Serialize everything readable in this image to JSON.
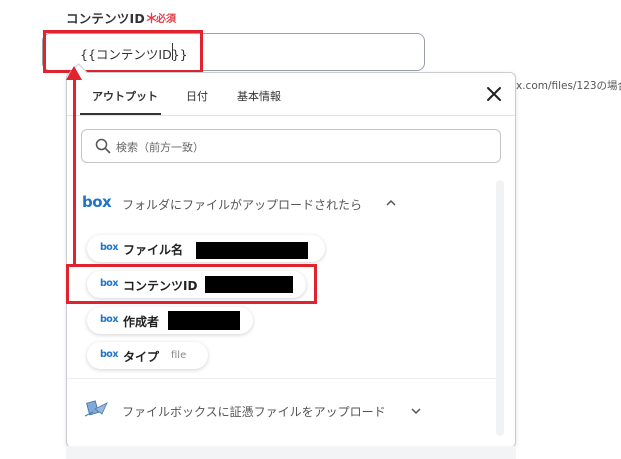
{
  "field": {
    "label": "コンテンツID",
    "required_star": "＊",
    "required_text": "必須",
    "value": "{{コンテンツID}}"
  },
  "background_hint": "x.com/files/123の場合、",
  "panel": {
    "tabs": [
      {
        "label": "アウトプット",
        "active": true
      },
      {
        "label": "日付",
        "active": false
      },
      {
        "label": "基本情報",
        "active": false
      }
    ],
    "search_placeholder": "検索（前方一致）",
    "group1": {
      "logo": "box",
      "title": "フォルダにファイルがアップロードされたら",
      "expanded": true,
      "items": [
        {
          "logo": "box",
          "label": "ファイル名",
          "redacted": true
        },
        {
          "logo": "box",
          "label": "コンテンツID",
          "redacted": true
        },
        {
          "logo": "box",
          "label": "作成者",
          "redacted": true
        },
        {
          "logo": "box",
          "label": "タイプ",
          "sub": "file"
        }
      ]
    },
    "group2": {
      "icon": "file-upload-icon",
      "title": "ファイルボックスに証憑ファイルをアップロード",
      "expanded": false
    }
  },
  "colors": {
    "highlight": "#e0242f",
    "box_brand": "#1f74c7",
    "required": "#e53d4a"
  }
}
